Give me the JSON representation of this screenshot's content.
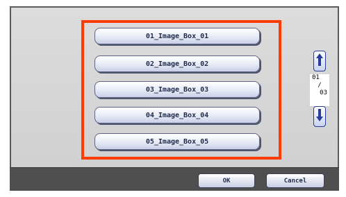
{
  "box_list": {
    "items": [
      {
        "label": "01_Image_Box_01"
      },
      {
        "label": "02_Image_Box_02"
      },
      {
        "label": "03_Image_Box_03"
      },
      {
        "label": "04_Image_Box_04"
      },
      {
        "label": "05_Image_Box_05"
      }
    ]
  },
  "pager": {
    "current": "01",
    "separator": "/",
    "total": "03",
    "up_icon": "arrow-up-icon",
    "down_icon": "arrow-down-icon"
  },
  "footer": {
    "ok_label": "OK",
    "cancel_label": "Cancel"
  },
  "colors": {
    "highlight": "#ff3b00",
    "panel": "#d6d6d6",
    "footer_bar": "#4f4f4f",
    "button_text": "#1e2a4a",
    "arrow": "#2a3c9b"
  }
}
